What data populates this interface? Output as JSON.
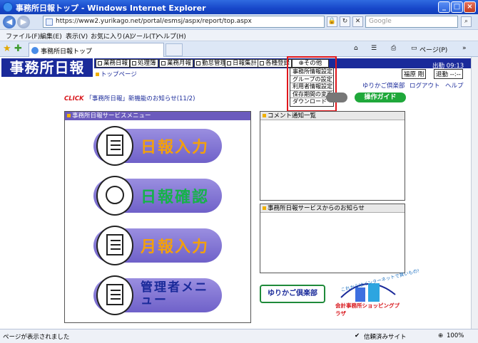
{
  "window": {
    "title": "事務所日報トップ - Windows Internet Explorer"
  },
  "address": {
    "url": "https://www2.yurikago.net/portal/esmsj/aspx/report/top.aspx",
    "search_placeholder": "Google"
  },
  "menubar": [
    "ファイル(F)",
    "編集(E)",
    "表示(V)",
    "お気に入り(A)",
    "ツール(T)",
    "ヘルプ(H)"
  ],
  "tab": {
    "title": "事務所日報トップ"
  },
  "tabtools": {
    "page_label": "ページ(P)"
  },
  "app": {
    "logo": "事務所日報",
    "breadcrumb": "トップページ",
    "nav": [
      "業務日報",
      "処理簿",
      "業務月報",
      "勤怠管理",
      "日報集計",
      "各種登録"
    ],
    "other_label": "その他",
    "dropdown": [
      "事務所情報設定",
      "グループの設定",
      "利用者情報設定",
      "保存期間の変更",
      "ダウンロード"
    ],
    "clock": "出勤 09:13",
    "user": "福原 剛",
    "leave": "退勤 --:--",
    "links": {
      "club": "ゆりかご倶楽部",
      "logout": "ログアウト",
      "help": "ヘルプ"
    },
    "notice": {
      "click": "CLICK",
      "text": "「事務所日報」新機能のお知らせ(11/2)"
    },
    "ops_guide": "操作ガイド",
    "service_menu_title": "事務所日報サービスメニュー",
    "big_buttons": [
      "日報入力",
      "日報確認",
      "月報入力",
      "管理者メニュー"
    ],
    "comment_title": "コメント通知一覧",
    "news_title": "事務所日報サービスからのお知らせ",
    "club_banner": "ゆりかご倶楽部",
    "plaza_caption": "会計事務所ショッピングプラザ",
    "plaza_tagline": "これからはインターネットで買いもの!"
  },
  "status": {
    "text": "ページが表示されました",
    "zone": "信頼済みサイト",
    "zoom": "100%"
  }
}
